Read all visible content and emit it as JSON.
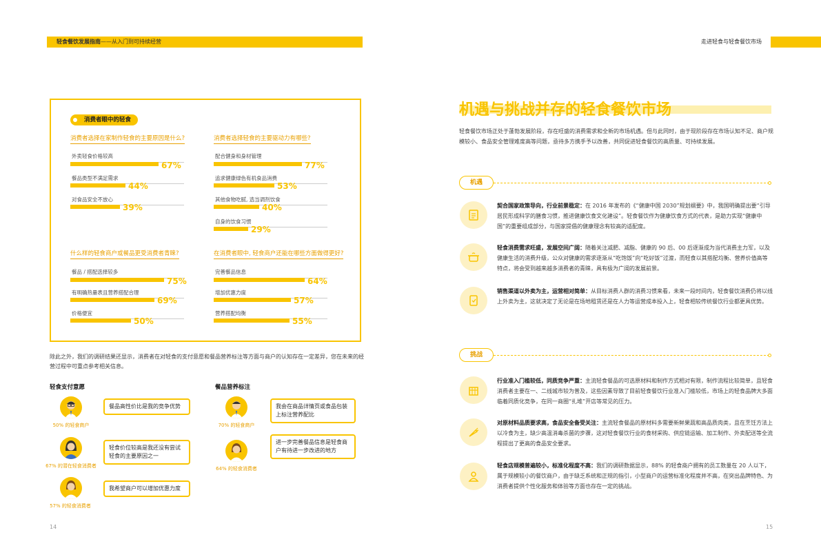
{
  "header": {
    "left_title": "轻食餐饮发展指南",
    "left_sub": "——从入门到可持续经营",
    "right_title": "走进轻食与轻食餐饮市场"
  },
  "left": {
    "section_tag": "消费者眼中的轻食",
    "q1": {
      "title": "消费者选择在家制作轻食的主要原因是什么?",
      "bars": [
        {
          "label": "外卖轻食价格较高",
          "pct": "67%",
          "value": 67
        },
        {
          "label": "餐品类型不满足需求",
          "pct": "44%",
          "value": 44
        },
        {
          "label": "对食品安全不放心",
          "pct": "39%",
          "value": 39
        }
      ]
    },
    "q2": {
      "title": "消费者选择轻食的主要驱动力有哪些?",
      "bars": [
        {
          "label": "配合健身和身材管理",
          "pct": "77%",
          "value": 77
        },
        {
          "label": "追求健康绿色有机食品消费",
          "pct": "53%",
          "value": 53
        },
        {
          "label": "其他食物吃腻, 选当调剂饮食",
          "pct": "40%",
          "value": 40
        },
        {
          "label": "自身的饮食习惯",
          "pct": "29%",
          "value": 29
        }
      ]
    },
    "q3": {
      "title": "什么样的轻食商户或餐品更受消费者青睐?",
      "bars": [
        {
          "label": "餐品 / 搭配选择较多",
          "pct": "75%",
          "value": 75
        },
        {
          "label": "有明确热量表且营养搭配合理",
          "pct": "69%",
          "value": 69
        },
        {
          "label": "价格便宜",
          "pct": "50%",
          "value": 50
        }
      ]
    },
    "q4": {
      "title": "在消费者眼中, 轻食商户还能在哪些方面做得更好?",
      "bars": [
        {
          "label": "完善餐品信息",
          "pct": "64%",
          "value": 64
        },
        {
          "label": "增加优惠力度",
          "pct": "57%",
          "value": 57
        },
        {
          "label": "营养搭配均衡",
          "pct": "55%",
          "value": 55
        }
      ]
    },
    "paragraph": "除此之外，我们的调研结果还显示，消费者在对轻食的支付意愿和餐品营养标注等方面与商户的认知存在一定差异，您在未来的经营过程中可重点参考相关信息。",
    "pay": {
      "heading": "轻食支付意愿",
      "rows": [
        {
          "caption": "50% 的轻食商户",
          "quote": "餐品高性价比是我的竞争优势"
        },
        {
          "caption": "67% 的潜在轻食消费者",
          "quote": "轻食价位较高是我还没有尝试轻食的主要原因之一"
        },
        {
          "caption": "57% 的轻食消费者",
          "quote": "我希望商户可以增加优惠力度"
        }
      ]
    },
    "nutrition": {
      "heading": "餐品营养标注",
      "rows": [
        {
          "caption": "70% 的轻食商户",
          "quote": "我会在商品详情页或食品包装上标注营养配比"
        },
        {
          "caption": "64% 的轻食消费者",
          "quote": "进一步完善餐品信息是轻食商户有待进一步改进的地方"
        }
      ]
    },
    "page_number": "14"
  },
  "right": {
    "title": "机遇与挑战并存的轻食餐饮市场",
    "intro": "轻食餐饮市场正处于蓬勃发展阶段，存在旺盛的消费需求和全新的市场机遇。但与此同时，由于现阶段存在市场认知不足、商户规模较小、食品安全管理难度高等问题，亟待多方携手予以改善，共同促进轻食餐饮的高质量、可持续发展。",
    "opportunities": {
      "label": "机遇",
      "items": [
        {
          "icon": "document-icon",
          "bold": "契合国家政策导向，行业前景稳定：",
          "text": "在 2016 年发布的《“健康中国 2030”规划纲要》中，我国明确提出要“引导居民形成科学的膳食习惯，推进健康饮食文化建设”。轻食餐饮作为健康饮食方式的代表，是助力实现“健康中国”的重要组成部分，与国家提倡的健康理念有较高的适配度。"
        },
        {
          "icon": "cooking-pot-icon",
          "bold": "轻食消费需求旺盛，发展空间广阔：",
          "text": "随着关注减肥、减脂、健康的 90 后、00 后逐渐成为当代消费主力军，以及健康生活的消费升级，公众对健康的需求逐渐从“吃饱饭”向“吃好饭”过渡，而轻食以其搭配均衡、营养价值高等特点，将会受到越来越多消费者的青睐，具有极为广阔的发展前景。"
        },
        {
          "icon": "mobile-order-icon",
          "bold": "销售渠道以外卖为主，运营相对简单：",
          "text": "从目标消费人群的消费习惯来看，未来一段时间内，轻食餐饮消费仍将以线上外卖为主，这就决定了无论是在场地租赁还是在人力等运营成本投入上，轻食相较传统餐饮行业都更具优势。"
        }
      ]
    },
    "challenges": {
      "label": "挑战",
      "items": [
        {
          "icon": "storefront-icon",
          "bold": "行业准入门槛较低，同质竞争严重：",
          "text": "主流轻食餐品的可选原材料和制作方式相对有限，制作流程比较简单，且轻食消费者主要在一、二线城市较为普及，这些因素导致了目前轻食餐饮行业准入门槛较低，市场上的轻食品牌大多面临着同质化竞争，在同一商圈“扎堆”开店等常见的压力。"
        },
        {
          "icon": "carrot-icon",
          "bold": "对原材料品质要求高，食品安全备受关注：",
          "text": "主流轻食餐品的原材料多需要新鲜果蔬和高品质肉类，且在烹饪方法上以冷食为主，缺少高温消毒杀菌的步骤，这对轻食餐饮行业的食材采购、供应链运输、加工制作、外卖配送等全流程提出了更高的食品安全要求。"
        },
        {
          "icon": "person-icon",
          "bold": "轻食店规模普遍较小，标准化程度不高：",
          "text": "我们的调研数据显示，88% 的轻食商户拥有的员工数量在 20 人以下，属于规模较小的餐饮商户，由于缺乏系统和正规的指引，小型商户的运营标准化程度并不高，在突出品牌特色、为消费者提供个性化服务和体验等方面也存在一定的挑战。"
        }
      ]
    },
    "page_number": "15"
  },
  "colors": {
    "accent": "#f9c400",
    "accent_text": "#e8a000",
    "highlight": "#fdf0b0"
  }
}
